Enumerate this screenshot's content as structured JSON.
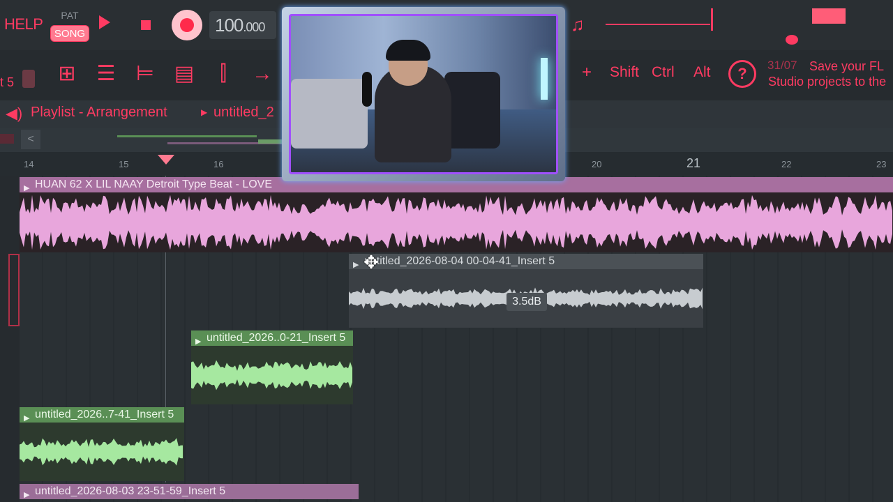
{
  "transport": {
    "help_label": "HELP",
    "pat_label": "PAT",
    "song_label": "SONG",
    "tempo_value": "100",
    "tempo_decimal": ".000"
  },
  "toolbar": {
    "insert_label": "t 5",
    "plus_label": "+",
    "shift_label": "Shift",
    "ctrl_label": "Ctrl",
    "alt_label": "Alt"
  },
  "hint": {
    "count": "31/07",
    "text_line1": "Save your FL",
    "text_line2": "Studio projects to the"
  },
  "playlist": {
    "title": "Playlist - Arrangement",
    "pattern": "untitled_2",
    "scroll_left_icon": "<"
  },
  "ruler": {
    "bars": [
      "14",
      "15",
      "16",
      "20",
      "21",
      "22",
      "23"
    ]
  },
  "clips": {
    "beat": "HUAN 62 X LIL NAAY Detroit Type Beat - LOVE",
    "selected": "untitled_2026-08-04 00-04-41_Insert 5",
    "selected_gain": "3.5dB",
    "green1": "untitled_2026..0-21_Insert 5",
    "green2": "untitled_2026..7-41_Insert 5",
    "bottom": "untitled_2026-08-03 23-51-59_Insert 5"
  },
  "colors": {
    "accent": "#ff3b62",
    "pink_clip": "#e8a6dc",
    "grey_clip": "#c7ccd0",
    "green_clip": "#a6e8a0"
  },
  "icons": {
    "play": "play-icon",
    "stop": "stop-icon",
    "record": "record-icon",
    "speaker": "speaker-icon",
    "cursor": "move-cursor-icon",
    "hint": "hint-bulb-icon"
  }
}
